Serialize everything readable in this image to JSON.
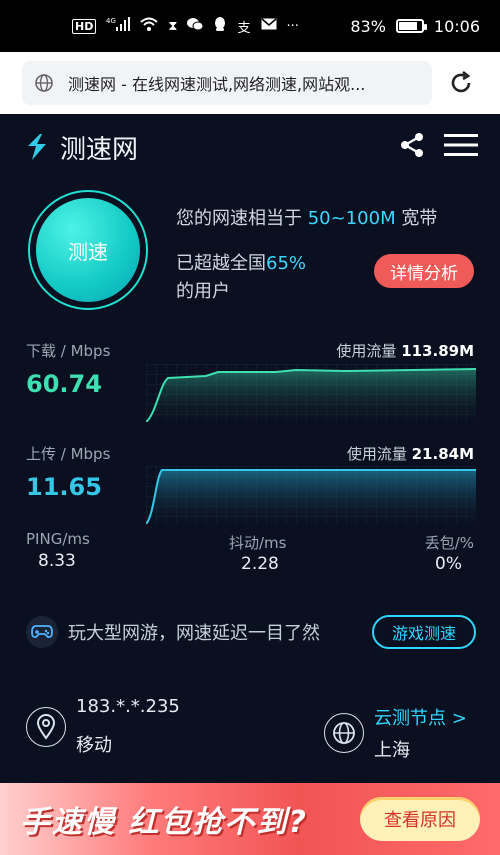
{
  "status_bar": {
    "left_icons": [
      "hd-icon",
      "4g-signal-icon",
      "wifi-icon",
      "hourglass-icon",
      "wechat-icon",
      "qq-icon",
      "alipay-icon",
      "mail-icon",
      "more-icon"
    ],
    "battery_percent": "83%",
    "battery_level": 0.83,
    "time": "10:06"
  },
  "address_bar": {
    "url_title": "测速网 - 在线网速测试,网络测速,网站观..."
  },
  "header": {
    "brand": "测速网"
  },
  "speed_test": {
    "button_label": "测速",
    "compare_prefix": "您的网速相当于",
    "compare_range": "50~100M",
    "compare_suffix": "宽带",
    "rank_prefix": "已超越全国",
    "rank_percent": "65%",
    "rank_suffix": "的用户",
    "detail_button": "详情分析"
  },
  "download": {
    "label": "下载 / Mbps",
    "value": "60.74",
    "usage_label": "使用流量",
    "usage_value": "113.89M",
    "color": "#3de0b0"
  },
  "upload": {
    "label": "上传 / Mbps",
    "value": "11.65",
    "usage_label": "使用流量",
    "usage_value": "21.84M",
    "color": "#35c7e8"
  },
  "stats": {
    "ping_label": "PING/ms",
    "ping_value": "8.33",
    "jitter_label": "抖动/ms",
    "jitter_value": "2.28",
    "loss_label": "丢包/%",
    "loss_value": "0%"
  },
  "game": {
    "text": "玩大型网游，网速延迟一目了然",
    "button": "游戏测速"
  },
  "location": {
    "ip": "183.*.*.235",
    "isp": "移动",
    "node_link": "云测节点 >",
    "city": "上海"
  },
  "banner": {
    "text": "手速慢 红包抢不到?",
    "button": "查看原因"
  },
  "colors": {
    "accent": "#2fd6ff",
    "background": "#0b1020",
    "danger": "#ef5b58"
  }
}
